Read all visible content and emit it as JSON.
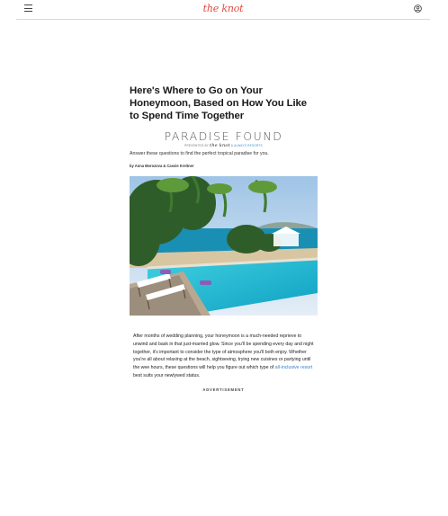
{
  "header": {
    "logo": "the knot",
    "menu_icon": "hamburger-menu-icon",
    "account_icon": "user-account-icon"
  },
  "article": {
    "headline": "Here's Where to Go on Your Honeymoon, Based on How You Like to Spend Time Together",
    "brand_title": "PARADISE FOUND",
    "presented_by": "PRESENTED BY",
    "presented_knot": "the knot",
    "presented_and": "&",
    "presented_partner": "ALWAYS RESORTS",
    "dek": "Answer these questions to find the perfect tropical paradise for you.",
    "byline": "by Anna Morozova & Cassie Kreitner",
    "body_before_link": "After months of wedding planning, your honeymoon is a much-needed reprieve to unwind and bask in that just-married glow. Since you'll be spending every day and night together, it's important to consider the type of atmosphere you'll both enjoy. Whether you're all about relaxing at the beach, sightseeing, trying new cuisines or partying until the wee hours, these questions will help you figure out which type of ",
    "body_link": "all-inclusive resort",
    "body_after_link": " best suits your newlywed status.",
    "advertisement": "ADVERTISEMENT"
  },
  "colors": {
    "brand_red": "#e0483f",
    "link_blue": "#3a7fc4",
    "divider": "#d9d9d9"
  }
}
